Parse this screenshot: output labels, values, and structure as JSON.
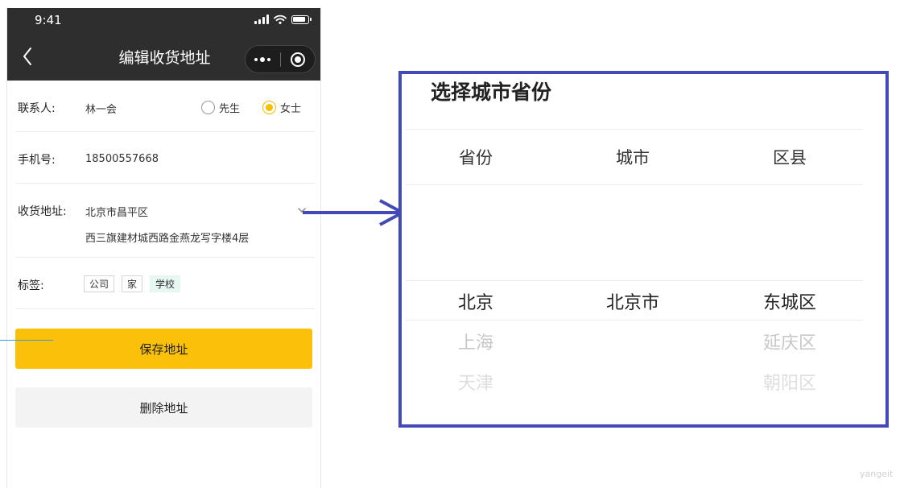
{
  "status": {
    "time": "9:41"
  },
  "nav": {
    "title": "编辑收货地址"
  },
  "form": {
    "contact": {
      "label": "联系人:",
      "value": "林一会",
      "gender_options": [
        "先生",
        "女士"
      ],
      "selected": "女士"
    },
    "phone": {
      "label": "手机号:",
      "value": "18500557668"
    },
    "address": {
      "label": "收货地址:",
      "region": "北京市昌平区",
      "detail": "西三旗建材城西路金燕龙写字楼4层"
    },
    "tags": {
      "label": "标签:",
      "items": [
        "公司",
        "家",
        "学校"
      ],
      "active": "学校"
    }
  },
  "buttons": {
    "save": "保存地址",
    "delete": "删除地址"
  },
  "picker": {
    "title": "选择城市省份",
    "columns": [
      "省份",
      "城市",
      "区县"
    ],
    "provinces": [
      "北京",
      "上海",
      "天津"
    ],
    "cities": [
      "北京市"
    ],
    "districts": [
      "东城区",
      "延庆区",
      "朝阳区"
    ]
  },
  "colors": {
    "accent": "#fbc10a",
    "picker_border": "#4349b6",
    "topbar": "#2e2e2e"
  },
  "watermark": "yangeit"
}
